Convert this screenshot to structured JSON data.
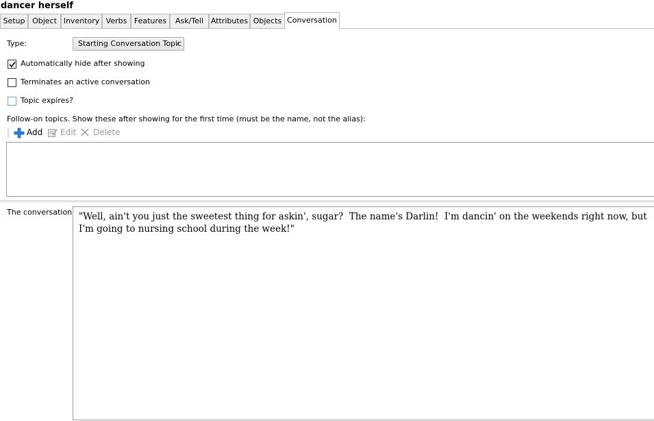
{
  "window": {
    "title": "dancer herself"
  },
  "tabs": [
    {
      "label": "Setup"
    },
    {
      "label": "Object"
    },
    {
      "label": "Inventory"
    },
    {
      "label": "Verbs"
    },
    {
      "label": "Features"
    },
    {
      "label": "Ask/Tell"
    },
    {
      "label": "Attributes"
    },
    {
      "label": "Objects"
    },
    {
      "label": "Conversation",
      "active": true
    }
  ],
  "form": {
    "type_label": "Type:",
    "type_value": "Starting Conversation Topic",
    "checkboxes": [
      {
        "label": "Automatically hide after showing",
        "checked": true
      },
      {
        "label": "Terminates an active conversation",
        "checked": false
      },
      {
        "label": "Topic expires?",
        "checked": false
      }
    ],
    "followon_label": "Follow-on topics. Show these after showing for the first time (must be the name, not the alias):",
    "toolbar": {
      "add_label": "Add",
      "edit_label": "Edit",
      "delete_label": "Delete"
    },
    "followon_items": [],
    "conversation_label": "The conversation:",
    "conversation_text": "\"Well, ain't you just the sweetest thing for askin', sugar?  The name's Darlin!  I'm dancin' on the weekends right now, but I'm going to nursing school during the week!\""
  },
  "colors": {
    "add_icon_blue": "#2f7fd6",
    "disabled_text": "#9a9a9a",
    "tab_border": "#b9b9b9"
  }
}
